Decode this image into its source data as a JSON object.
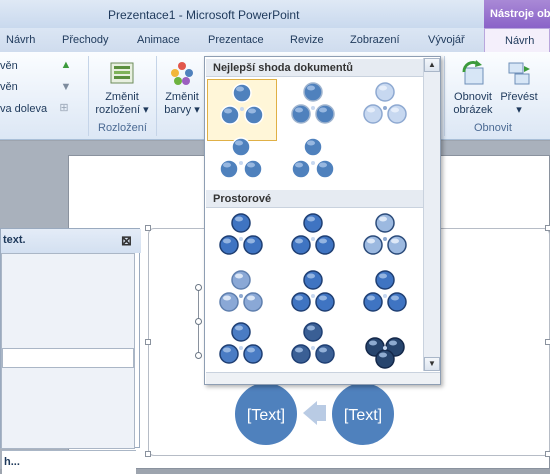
{
  "window": {
    "title": "Prezentace1 - Microsoft PowerPoint",
    "context_tab_group": "Nástroje obr"
  },
  "tabs": [
    "Návrh",
    "Přechody",
    "Animace",
    "Prezentace",
    "Revize",
    "Zobrazení",
    "Vývojář"
  ],
  "context_tab": "Návrh",
  "ribbon": {
    "left_items": [
      "věn",
      "věn",
      "va doleva"
    ],
    "change_layout": {
      "line1": "Změnit",
      "line2": "rozložení ▾"
    },
    "layouts_group": "Rozložení",
    "change_colors": {
      "line1": "Změnit",
      "line2": "barvy ▾"
    },
    "reset_graphic": {
      "line1": "Obnovit",
      "line2": "obrázek"
    },
    "convert": {
      "line1": "Převést",
      "line2": "▾"
    },
    "reset_group": "Obnovit"
  },
  "gallery": {
    "section_best": "Nejlepší shoda dokumentů",
    "section_3d": "Prostorové",
    "selected_index": 0
  },
  "text_pane": {
    "title": "text.",
    "footer": "h..."
  },
  "diagram": {
    "placeholder_left": "[Text]",
    "placeholder_right": "[Text]",
    "accent": "#4f81bd"
  }
}
